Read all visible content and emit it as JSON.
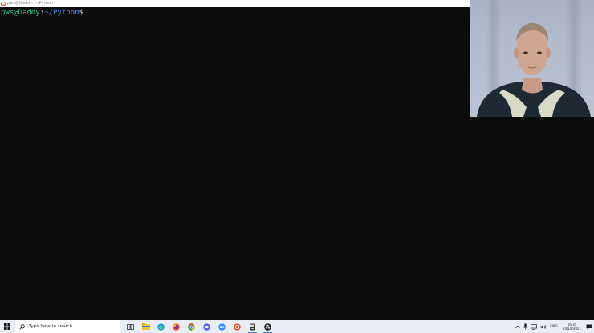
{
  "window": {
    "title": "pws@Daddy: ~/Python"
  },
  "terminal": {
    "user_host": "pws@Daddy",
    "colon": ":",
    "path": "~/Python",
    "dollar": "$"
  },
  "taskbar": {
    "search_placeholder": "Type here to search",
    "apps": [
      {
        "name": "task-view-icon",
        "color": "#333333"
      },
      {
        "name": "file-explorer-icon",
        "color": "#f2c232"
      },
      {
        "name": "edge-icon",
        "color": "#1ba0d8"
      },
      {
        "name": "firefox-icon",
        "color": "#e5502a"
      },
      {
        "name": "chrome-icon",
        "color": "#2fa84f"
      },
      {
        "name": "discord-icon",
        "color": "#5865f2"
      },
      {
        "name": "zoom-icon",
        "color": "#2d8cff"
      },
      {
        "name": "ubuntu-icon",
        "color": "#e95420"
      },
      {
        "name": "terminal-app-icon",
        "color": "#2b2b2b"
      },
      {
        "name": "obs-icon",
        "color": "#1a1a1a"
      }
    ],
    "tray": {
      "language": "ENG",
      "time": "16:35",
      "date": "24/10/2021"
    }
  }
}
